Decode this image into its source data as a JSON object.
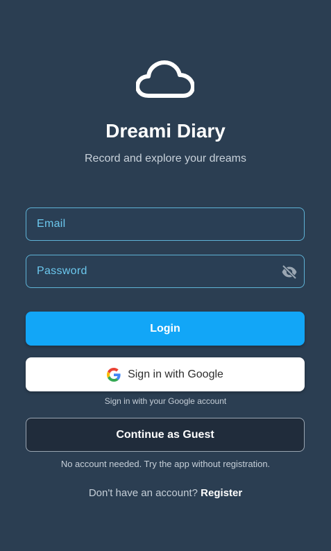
{
  "app": {
    "logo_icon": "cloud-icon",
    "title": "Dreami Diary",
    "subtitle": "Record and explore your dreams"
  },
  "form": {
    "email_placeholder": "Email",
    "email_value": "",
    "password_placeholder": "Password",
    "password_value": "",
    "password_toggle_icon": "eye-off-icon"
  },
  "actions": {
    "login_label": "Login",
    "google_label": "Sign in with Google",
    "google_icon": "google-icon",
    "google_hint": "Sign in with your Google account",
    "guest_label": "Continue as Guest",
    "guest_hint": "No account needed. Try the app without registration.",
    "register_prompt": "Don't have an account?",
    "register_link": "Register"
  },
  "colors": {
    "background": "#2b3e52",
    "primary": "#12a6f7",
    "field_border": "#5fb3d6",
    "placeholder": "#6cc8ee",
    "guest_button": "#202c3b"
  }
}
